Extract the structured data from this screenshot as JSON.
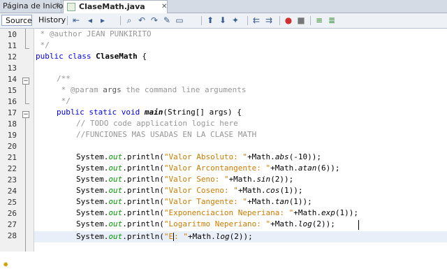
{
  "tabs": [
    {
      "label": "Página de Inicio",
      "active": false
    },
    {
      "label": "ClaseMath.java",
      "active": true
    }
  ],
  "editor_toolbar": {
    "source_label": "Source",
    "history_label": "History"
  },
  "line_numbers": [
    "10",
    "11",
    "12",
    "13",
    "14",
    "15",
    "16",
    "17",
    "18",
    "19",
    "20",
    "21",
    "22",
    "23",
    "24",
    "25",
    "26",
    "27",
    "28"
  ],
  "code": {
    "l10_comment": " * @author JEAN PUNKIRITO",
    "l11_comment": " */",
    "l12_kw": "public class",
    "l12_name": " ClaseMath",
    "l12_brace": " {",
    "l14_comment": "/**",
    "l15_comment_a": " * @param ",
    "l15_comment_b": "args",
    "l15_comment_c": " the command line arguments",
    "l16_comment": " */",
    "l17_kw": "public static void",
    "l17_name": " main",
    "l17_rest": "(String[] args) {",
    "l18_comment": "// TODO code application logic here",
    "l19_comment": "//FUNCIONES MAS USADAS EN LA CLASE MATH",
    "sys": "System.",
    "out": "out",
    "println": ".println(",
    "lines": [
      {
        "str": "\"Valor Absoluto: \"",
        "mid": "+Math.",
        "fn": "abs",
        "end": "(-10));"
      },
      {
        "str": "\"Valor Arcontangente: \"",
        "mid": "+Math.",
        "fn": "atan",
        "end": "(6));"
      },
      {
        "str": "\"Valor Seno: \"",
        "mid": "+Math.",
        "fn": "sin",
        "end": "(2));"
      },
      {
        "str": "\"Valor Coseno: \"",
        "mid": "+Math.",
        "fn": "cos",
        "end": "(1));"
      },
      {
        "str": "\"Valor Tangente: \"",
        "mid": "+Math.",
        "fn": "tan",
        "end": "(1));"
      },
      {
        "str": "\"Exponenciacion Neperiana: \"",
        "mid": "+Math.",
        "fn": "exp",
        "end": "(1));"
      },
      {
        "str": "\"Logaritmo Neperiano: \"",
        "mid": "+Math.",
        "fn": "log",
        "end": "(2));"
      }
    ],
    "l28_str_a": "\"E",
    "l28_str_b": ": \"",
    "l28_mid": "+Math.",
    "l28_fn": "log",
    "l28_end": "(2));"
  }
}
